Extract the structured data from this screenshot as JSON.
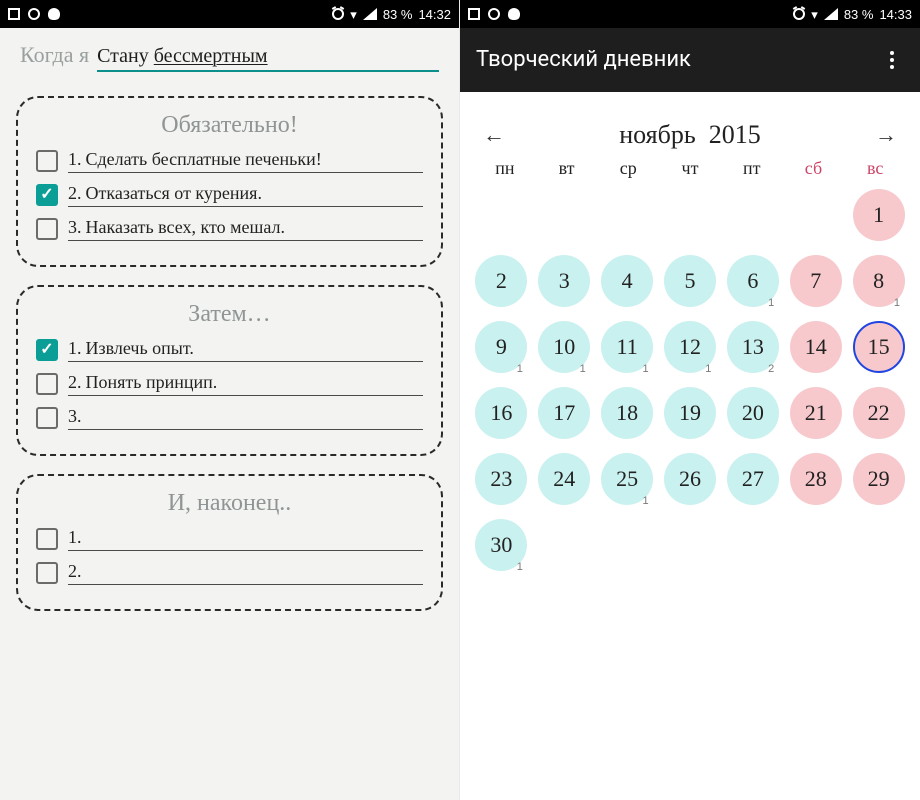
{
  "left": {
    "status": {
      "battery": "83 %",
      "time": "14:32"
    },
    "prompt": {
      "prefix": "Когда я",
      "answer_plain": "Стану ",
      "answer_underlined": "бессмертным"
    },
    "sections": [
      {
        "title": "Обязательно!",
        "items": [
          {
            "n": "1.",
            "text": "Сделать бесплатные печеньки!",
            "checked": false
          },
          {
            "n": "2.",
            "text": "Отказаться от курения.",
            "checked": true
          },
          {
            "n": "3.",
            "text": "Наказать всех, кто мешал.",
            "checked": false
          }
        ]
      },
      {
        "title": "Затем…",
        "items": [
          {
            "n": "1.",
            "text": "Извлечь опыт.",
            "checked": true
          },
          {
            "n": "2.",
            "text": "Понять принцип.",
            "checked": false
          },
          {
            "n": "3.",
            "text": "",
            "checked": false
          }
        ]
      },
      {
        "title": "И, наконец..",
        "items": [
          {
            "n": "1.",
            "text": "",
            "checked": false
          },
          {
            "n": "2.",
            "text": "",
            "checked": false
          }
        ]
      }
    ]
  },
  "right": {
    "status": {
      "battery": "83 %",
      "time": "14:33"
    },
    "appbar_title": "Творческий дневник",
    "month": "ноябрь",
    "year": "2015",
    "dow": [
      "пн",
      "вт",
      "ср",
      "чт",
      "пт",
      "сб",
      "вс"
    ],
    "days": [
      {
        "d": "",
        "w": false
      },
      {
        "d": "",
        "w": false
      },
      {
        "d": "",
        "w": false
      },
      {
        "d": "",
        "w": false
      },
      {
        "d": "",
        "w": false
      },
      {
        "d": "",
        "w": false
      },
      {
        "d": 1,
        "w": true
      },
      {
        "d": 2,
        "w": false
      },
      {
        "d": 3,
        "w": false
      },
      {
        "d": 4,
        "w": false
      },
      {
        "d": 5,
        "w": false
      },
      {
        "d": 6,
        "w": false,
        "b": 1
      },
      {
        "d": 7,
        "w": true
      },
      {
        "d": 8,
        "w": true,
        "b": 1
      },
      {
        "d": 9,
        "w": false,
        "b": 1
      },
      {
        "d": 10,
        "w": false,
        "b": 1
      },
      {
        "d": 11,
        "w": false,
        "b": 1
      },
      {
        "d": 12,
        "w": false,
        "b": 1
      },
      {
        "d": 13,
        "w": false,
        "b": 2
      },
      {
        "d": 14,
        "w": true
      },
      {
        "d": 15,
        "w": true,
        "today": true
      },
      {
        "d": 16,
        "w": false
      },
      {
        "d": 17,
        "w": false
      },
      {
        "d": 18,
        "w": false
      },
      {
        "d": 19,
        "w": false
      },
      {
        "d": 20,
        "w": false
      },
      {
        "d": 21,
        "w": true
      },
      {
        "d": 22,
        "w": true
      },
      {
        "d": 23,
        "w": false
      },
      {
        "d": 24,
        "w": false
      },
      {
        "d": 25,
        "w": false,
        "b": 1
      },
      {
        "d": 26,
        "w": false
      },
      {
        "d": 27,
        "w": false
      },
      {
        "d": 28,
        "w": true
      },
      {
        "d": 29,
        "w": true
      },
      {
        "d": 30,
        "w": false,
        "b": 1
      }
    ]
  }
}
